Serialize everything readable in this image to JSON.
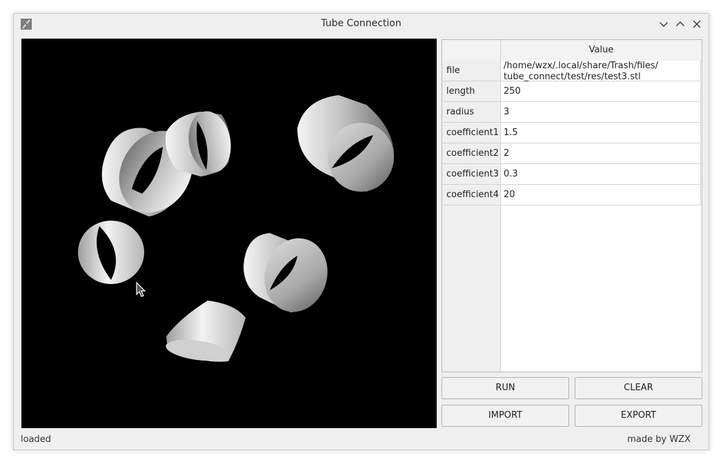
{
  "window": {
    "title": "Tube Connection"
  },
  "properties": {
    "header": "Value",
    "rows": [
      {
        "key": "file",
        "value": "/home/wzx/.local/share/Trash/files/\ntube_connect/test/res/test3.stl"
      },
      {
        "key": "length",
        "value": "250"
      },
      {
        "key": "radius",
        "value": "3"
      },
      {
        "key": "coefficient1",
        "value": "1.5"
      },
      {
        "key": "coefficient2",
        "value": "2"
      },
      {
        "key": "coefficient3",
        "value": "0.3"
      },
      {
        "key": "coefficient4",
        "value": "20"
      }
    ]
  },
  "buttons": {
    "run": "RUN",
    "clear": "CLEAR",
    "import": "IMPORT",
    "export": "EXPORT"
  },
  "status": {
    "left": "loaded",
    "right": "made by WZX"
  },
  "icons": {
    "app": "x-app-icon",
    "minimize": "chevron-down-icon",
    "maximize": "chevron-up-icon",
    "close": "close-icon",
    "cursor": "mouse-cursor-icon"
  },
  "colors": {
    "viewport_background": "#000000",
    "window_background": "#efefef"
  }
}
